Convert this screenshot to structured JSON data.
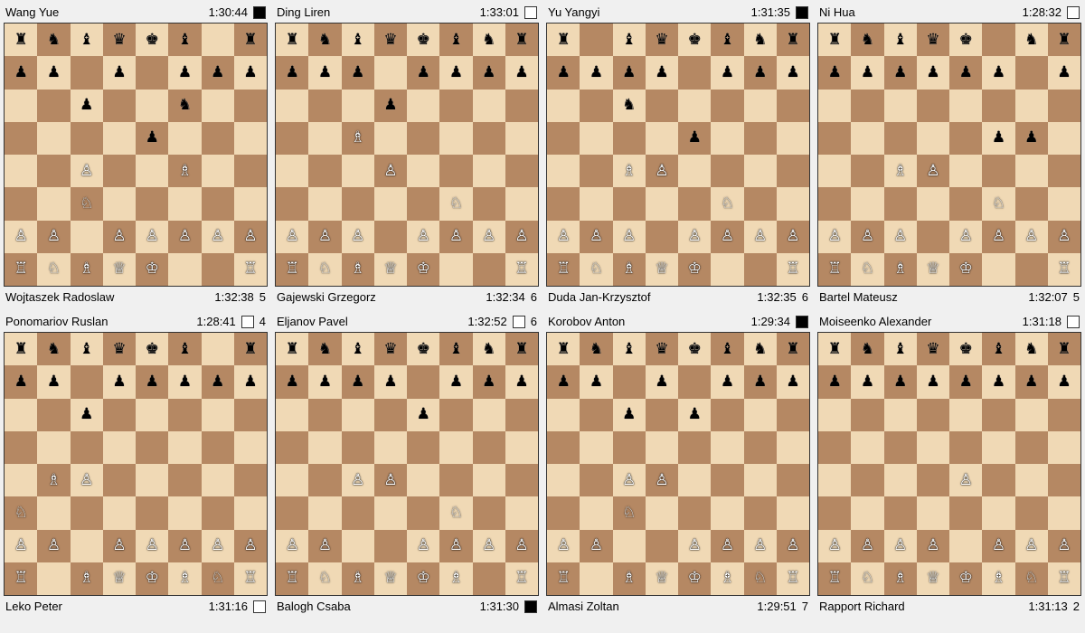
{
  "games": [
    {
      "id": "game1",
      "white": {
        "name": "Wang Yue",
        "clock": "1:30:44",
        "color": "black"
      },
      "black": {
        "name": "Wojtaszek Radoslaw",
        "clock": "1:32:38",
        "moves": "5"
      },
      "board": [
        [
          "br",
          "bn",
          "bb",
          "bq",
          "bk",
          "bb",
          null,
          "br"
        ],
        [
          "bp",
          "bp",
          null,
          "bp",
          null,
          "bp",
          "bp",
          "bp"
        ],
        [
          null,
          null,
          "bp",
          null,
          null,
          "bn",
          null,
          null
        ],
        [
          null,
          null,
          null,
          null,
          "bp",
          null,
          null,
          null
        ],
        [
          null,
          null,
          "wp",
          null,
          null,
          "wb",
          null,
          null
        ],
        [
          null,
          null,
          "wn",
          null,
          null,
          null,
          null,
          null
        ],
        [
          "wp",
          "wp",
          null,
          "wp",
          "wp",
          "wp",
          "wp",
          "wp"
        ],
        [
          "wr",
          "wn",
          "wb",
          "wq",
          "wk",
          null,
          null,
          "wr"
        ]
      ]
    },
    {
      "id": "game2",
      "white": {
        "name": "Ding Liren",
        "clock": "1:33:01",
        "color": "white"
      },
      "black": {
        "name": "Gajewski Grzegorz",
        "clock": "1:32:34",
        "moves": "6"
      },
      "board": [
        [
          "br",
          "bn",
          "bb",
          "bq",
          "bk",
          "bb",
          "bn",
          "br"
        ],
        [
          "bp",
          "bp",
          "bp",
          null,
          "bp",
          "bp",
          "bp",
          "bp"
        ],
        [
          null,
          null,
          null,
          "bp",
          null,
          null,
          null,
          null
        ],
        [
          null,
          null,
          "wb",
          null,
          null,
          null,
          null,
          null
        ],
        [
          null,
          null,
          null,
          "wp",
          null,
          null,
          null,
          null
        ],
        [
          null,
          null,
          null,
          null,
          null,
          "wn",
          null,
          null
        ],
        [
          "wp",
          "wp",
          "wp",
          null,
          "wp",
          "wp",
          "wp",
          "wp"
        ],
        [
          "wr",
          "wn",
          "wb",
          "wq",
          "wk",
          null,
          null,
          "wr"
        ]
      ]
    },
    {
      "id": "game3",
      "white": {
        "name": "Yu Yangyi",
        "clock": "1:31:35",
        "color": "black"
      },
      "black": {
        "name": "Duda Jan-Krzysztof",
        "clock": "1:32:35",
        "moves": "6"
      },
      "board": [
        [
          "br",
          null,
          "bb",
          "bq",
          "bk",
          "bb",
          "bn",
          "br"
        ],
        [
          "bp",
          "bp",
          "bp",
          "bp",
          null,
          "bp",
          "bp",
          "bp"
        ],
        [
          null,
          null,
          "bn",
          null,
          null,
          null,
          null,
          null
        ],
        [
          null,
          null,
          null,
          null,
          "bp",
          null,
          null,
          null
        ],
        [
          null,
          null,
          "wb",
          "wp",
          null,
          null,
          null,
          null
        ],
        [
          null,
          null,
          null,
          null,
          null,
          "wn",
          null,
          null
        ],
        [
          "wp",
          "wp",
          "wp",
          null,
          "wp",
          "wp",
          "wp",
          "wp"
        ],
        [
          "wr",
          "wn",
          "wb",
          "wq",
          "wk",
          null,
          null,
          "wr"
        ]
      ]
    },
    {
      "id": "game4",
      "white": {
        "name": "Ni Hua",
        "clock": "1:28:32",
        "color": "white"
      },
      "black": {
        "name": "Bartel Mateusz",
        "clock": "1:32:07",
        "moves": "5"
      },
      "board": [
        [
          "br",
          "bn",
          "bb",
          "bq",
          "bk",
          null,
          "bn",
          "br"
        ],
        [
          "bp",
          "bp",
          "bp",
          "bp",
          "bp",
          "bp",
          null,
          "bp"
        ],
        [
          null,
          null,
          null,
          null,
          null,
          null,
          null,
          null
        ],
        [
          null,
          null,
          null,
          null,
          null,
          "bp",
          "bp",
          null
        ],
        [
          null,
          null,
          "wb",
          "wp",
          null,
          null,
          null,
          null
        ],
        [
          null,
          null,
          null,
          null,
          null,
          "wn",
          null,
          null
        ],
        [
          "wp",
          "wp",
          "wp",
          null,
          "wp",
          "wp",
          "wp",
          "wp"
        ],
        [
          "wr",
          "wn",
          "wb",
          "wq",
          "wk",
          null,
          null,
          "wr"
        ]
      ]
    },
    {
      "id": "game5",
      "white": {
        "name": "Ponomariov Ruslan",
        "clock": "1:28:41",
        "moves": "4"
      },
      "black": {
        "name": "Leko Peter",
        "clock": "1:31:16",
        "color": "white"
      },
      "board": [
        [
          "br",
          "bn",
          "bb",
          "bq",
          "bk",
          "bb",
          null,
          "br"
        ],
        [
          "bp",
          "bp",
          null,
          "bp",
          "bp",
          "bp",
          "bp",
          "bp"
        ],
        [
          null,
          null,
          "bp",
          null,
          null,
          null,
          null,
          null
        ],
        [
          null,
          null,
          null,
          null,
          null,
          null,
          null,
          null
        ],
        [
          null,
          "wb",
          "wp",
          null,
          null,
          null,
          null,
          null
        ],
        [
          "wn",
          null,
          null,
          null,
          null,
          null,
          null,
          null
        ],
        [
          "wp",
          "wp",
          null,
          "wp",
          "wp",
          "wp",
          "wp",
          "wp"
        ],
        [
          "wr",
          null,
          "wb",
          "wq",
          "wk",
          "wb",
          "wn",
          "wr"
        ]
      ]
    },
    {
      "id": "game6",
      "white": {
        "name": "Eljanov Pavel",
        "clock": "1:32:52",
        "moves": "6"
      },
      "black": {
        "name": "Balogh Csaba",
        "clock": "1:31:30",
        "color": "black"
      },
      "board": [
        [
          "br",
          "bn",
          "bb",
          "bq",
          "bk",
          "bb",
          "bn",
          "br"
        ],
        [
          "bp",
          "bp",
          "bp",
          "bp",
          null,
          "bp",
          "bp",
          "bp"
        ],
        [
          null,
          null,
          null,
          null,
          "bp",
          null,
          null,
          null
        ],
        [
          null,
          null,
          null,
          null,
          null,
          null,
          null,
          null
        ],
        [
          null,
          null,
          "wp",
          "wp",
          null,
          null,
          null,
          null
        ],
        [
          null,
          null,
          null,
          null,
          null,
          "wn",
          null,
          null
        ],
        [
          "wp",
          "wp",
          null,
          null,
          "wp",
          "wp",
          "wp",
          "wp"
        ],
        [
          "wr",
          "wn",
          "wb",
          "wq",
          "wk",
          "wb",
          null,
          "wr"
        ]
      ]
    },
    {
      "id": "game7",
      "white": {
        "name": "Korobov Anton",
        "clock": "1:29:34",
        "color": "black"
      },
      "black": {
        "name": "Almasi Zoltan",
        "clock": "1:29:51",
        "moves": "7"
      },
      "board": [
        [
          "br",
          "bn",
          "bb",
          "bq",
          "bk",
          "bb",
          "bn",
          "br"
        ],
        [
          "bp",
          "bp",
          null,
          "bp",
          null,
          "bp",
          "bp",
          "bp"
        ],
        [
          null,
          null,
          "bp",
          null,
          "bp",
          null,
          null,
          null
        ],
        [
          null,
          null,
          null,
          null,
          null,
          null,
          null,
          null
        ],
        [
          null,
          null,
          "wp",
          "wp",
          null,
          null,
          null,
          null
        ],
        [
          null,
          null,
          "wn",
          null,
          null,
          null,
          null,
          null
        ],
        [
          "wp",
          "wp",
          null,
          null,
          "wp",
          "wp",
          "wp",
          "wp"
        ],
        [
          "wr",
          null,
          "wb",
          "wq",
          "wk",
          "wb",
          "wn",
          "wr"
        ]
      ]
    },
    {
      "id": "game8",
      "white": {
        "name": "Moiseenko Alexander",
        "clock": "1:31:18",
        "color": "white"
      },
      "black": {
        "name": "Rapport Richard",
        "clock": "1:31:13",
        "moves": "2"
      },
      "board": [
        [
          "br",
          "bn",
          "bb",
          "bq",
          "bk",
          "bb",
          "bn",
          "br"
        ],
        [
          "bp",
          "bp",
          "bp",
          "bp",
          "bp",
          "bp",
          "bp",
          "bp"
        ],
        [
          null,
          null,
          null,
          null,
          null,
          null,
          null,
          null
        ],
        [
          null,
          null,
          null,
          null,
          null,
          null,
          null,
          null
        ],
        [
          null,
          null,
          null,
          null,
          "wp",
          null,
          null,
          null
        ],
        [
          null,
          null,
          null,
          null,
          null,
          null,
          null,
          null
        ],
        [
          "wp",
          "wp",
          "wp",
          "wp",
          null,
          "wp",
          "wp",
          "wp"
        ],
        [
          "wr",
          "wn",
          "wb",
          "wq",
          "wk",
          "wb",
          "wn",
          "wr"
        ]
      ]
    }
  ],
  "pieces": {
    "wk": "♔",
    "wq": "♕",
    "wr": "♖",
    "wb": "♗",
    "wn": "♘",
    "wp": "♙",
    "bk": "♚",
    "bq": "♛",
    "br": "♜",
    "bb": "♝",
    "bn": "♞",
    "bp": "♟"
  }
}
